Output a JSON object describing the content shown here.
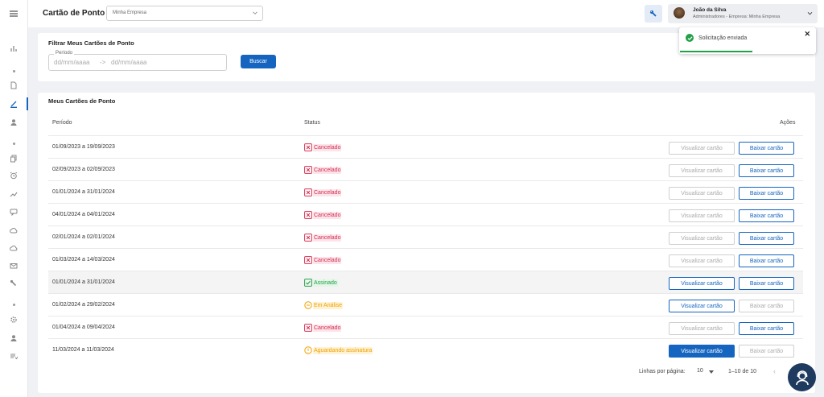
{
  "header": {
    "page_title": "Cartão de Ponto",
    "company_select": "Minha Empresa",
    "user": {
      "name": "João da Silva",
      "role": "Administradores - Empresa: Minha Empresa"
    }
  },
  "sidebar": {
    "icons": [
      "menu-icon",
      "bar-chart-icon",
      "document-icon",
      "pen-icon",
      "user-icon",
      "copy-icon",
      "alarm-icon",
      "trend-icon",
      "chat-icon",
      "cloud-icon",
      "cloud-icon",
      "mail-icon",
      "wrench-icon",
      "gear-icon",
      "user-icon",
      "list-icon"
    ]
  },
  "filter": {
    "title": "Filtrar Meus Cartões de Ponto",
    "period_label": "Período",
    "date_from_placeholder": "dd/mm/aaaa",
    "arrow": "->",
    "date_to_placeholder": "dd/mm/aaaa",
    "search_label": "Buscar"
  },
  "table": {
    "title": "Meus Cartões de Ponto",
    "columns": {
      "period": "Período",
      "status": "Status",
      "actions": "Ações"
    },
    "view_label": "Visualizar cartão",
    "download_label": "Baixar cartão",
    "rows": [
      {
        "period": "01/09/2023 a 19/09/2023",
        "status": "Cancelado",
        "kind": "cancel",
        "view": "disabled",
        "download": "outline"
      },
      {
        "period": "02/09/2023 a 02/09/2023",
        "status": "Cancelado",
        "kind": "cancel",
        "view": "disabled",
        "download": "outline"
      },
      {
        "period": "01/01/2024 a 31/01/2024",
        "status": "Cancelado",
        "kind": "cancel",
        "view": "disabled",
        "download": "outline"
      },
      {
        "period": "04/01/2024 a 04/01/2024",
        "status": "Cancelado",
        "kind": "cancel",
        "view": "disabled",
        "download": "outline"
      },
      {
        "period": "02/01/2024 a 02/01/2024",
        "status": "Cancelado",
        "kind": "cancel",
        "view": "disabled",
        "download": "outline"
      },
      {
        "period": "01/03/2024 a 14/03/2024",
        "status": "Cancelado",
        "kind": "cancel",
        "view": "disabled",
        "download": "outline"
      },
      {
        "period": "01/01/2024 a 31/01/2024",
        "status": "Assinado",
        "kind": "signed",
        "view": "outline",
        "download": "outline"
      },
      {
        "period": "01/02/2024 a 29/02/2024",
        "status": "Em Análise",
        "kind": "analysis",
        "view": "outline",
        "download": "disabled"
      },
      {
        "period": "01/04/2024 a 09/04/2024",
        "status": "Cancelado",
        "kind": "cancel",
        "view": "disabled",
        "download": "outline"
      },
      {
        "period": "11/03/2024 a 11/03/2024",
        "status": "Aguardando assinatura",
        "kind": "waiting",
        "view": "filled",
        "download": "disabled"
      }
    ]
  },
  "pagination": {
    "rows_per_page_label": "Linhas por página:",
    "rows_per_page": "10",
    "range": "1–10 de 10",
    "prev": "‹"
  },
  "toast": {
    "message": "Solicitação enviada",
    "close": "✕"
  },
  "colors": {
    "primary": "#1565c0",
    "cancel": "#d32f4f",
    "signed": "#22a045",
    "pending": "#f0a000",
    "help_fab": "#1e3a5f"
  }
}
